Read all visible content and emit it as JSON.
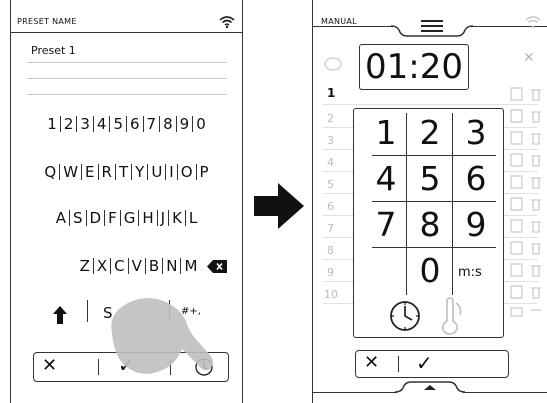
{
  "left": {
    "title": "PRESET NAME",
    "preset_value": "Preset 1",
    "number_row": [
      "1",
      "2",
      "3",
      "4",
      "5",
      "6",
      "7",
      "8",
      "9",
      "0"
    ],
    "row1": [
      "Q",
      "W",
      "E",
      "R",
      "T",
      "Y",
      "U",
      "I",
      "O",
      "P"
    ],
    "row2": [
      "A",
      "S",
      "D",
      "F",
      "G",
      "H",
      "J",
      "K",
      "L"
    ],
    "row3": [
      "Z",
      "X",
      "C",
      "V",
      "B",
      "N",
      "M"
    ],
    "space_label": "S",
    "symbols_label": "#+,",
    "cancel_glyph": "✕",
    "confirm_glyph": "✓"
  },
  "right": {
    "title": "MANUAL",
    "time": "01:20",
    "first_row_num": "1",
    "row_numbers": [
      "2",
      "3",
      "4",
      "5",
      "6",
      "7",
      "8",
      "9",
      "10"
    ],
    "keys": [
      "1",
      "2",
      "3",
      "4",
      "5",
      "6",
      "7",
      "8",
      "9",
      "0"
    ],
    "ms_label": "m:s",
    "close_glyph": "✕",
    "cancel_glyph": "✕",
    "confirm_glyph": "✓"
  }
}
